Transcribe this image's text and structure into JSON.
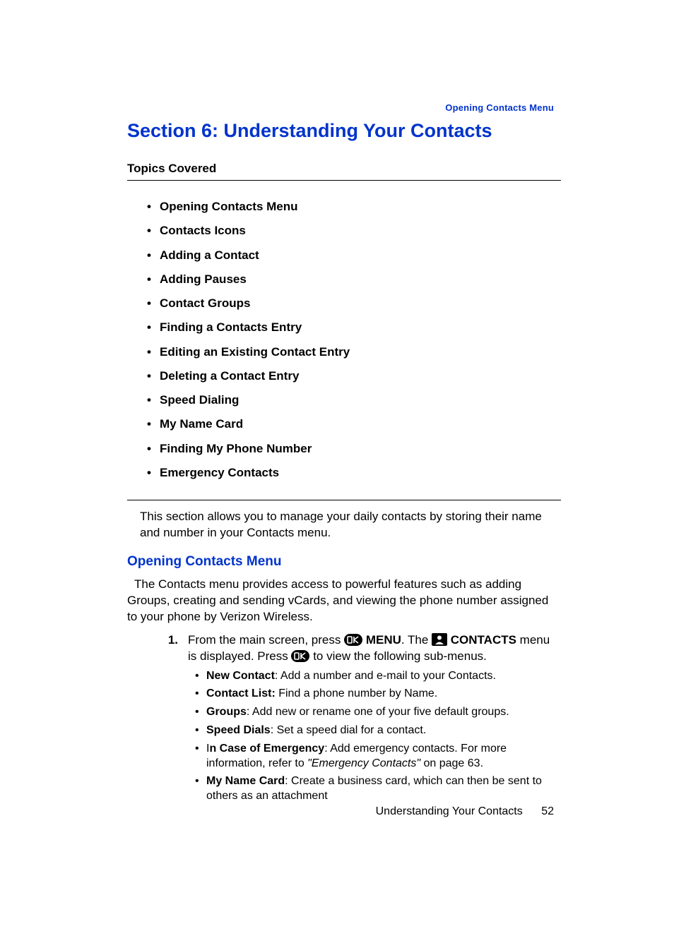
{
  "header": {
    "running_head": "Opening Contacts Menu"
  },
  "section_title": "Section 6: Understanding Your Contacts",
  "topics": {
    "label": "Topics Covered",
    "items": [
      "Opening Contacts Menu",
      "Contacts Icons",
      "Adding a Contact",
      "Adding Pauses",
      "Contact Groups",
      "Finding a Contacts Entry",
      "Editing an Existing Contact Entry",
      "Deleting a Contact Entry",
      "Speed Dialing",
      "My Name Card",
      "Finding My Phone Number",
      "Emergency Contacts"
    ]
  },
  "intro": "This section allows you to manage your daily contacts by storing their name and number in your Contacts menu.",
  "subheading": "Opening Contacts Menu",
  "opening_para": "The Contacts menu provides access to powerful features such as adding Groups, creating and sending vCards, and viewing the phone number assigned to your phone by Verizon Wireless.",
  "step": {
    "number": "1.",
    "pre_ok1": "From the main screen, press ",
    "menu_word": "MENU",
    "after_menu": ". The ",
    "contacts_word": "CONTACTS",
    "after_contacts": " menu is displayed. Press ",
    "after_ok2": " to view the following sub-menus.",
    "icons": {
      "ok": "ok-icon",
      "contacts": "contacts-icon"
    }
  },
  "submenus": [
    {
      "title": "New Contact",
      "desc": ": Add a number and e-mail to your Contacts."
    },
    {
      "title": "Contact List:",
      "desc": " Find a phone number by Name."
    },
    {
      "title": "Groups",
      "desc": ": Add new or rename one of your five default groups."
    },
    {
      "title": "Speed Dials",
      "desc": ": Set a speed dial for a contact."
    },
    {
      "title_prefix": "I",
      "title": "n Case of Emergency",
      "desc": ": Add emergency contacts. For more information, refer to ",
      "ref": "\"Emergency Contacts\"",
      "ref_tail": "  on page 63."
    },
    {
      "title": "My Name Card",
      "desc": ": Create a business card, which can then be sent to others as an attachment"
    }
  ],
  "footer": {
    "chapter": "Understanding Your Contacts",
    "page": "52"
  }
}
